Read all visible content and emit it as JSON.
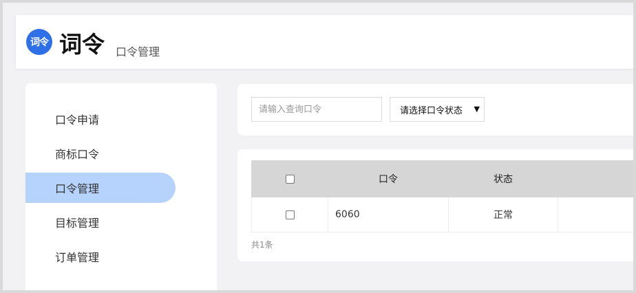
{
  "header": {
    "logo_text": "词令",
    "brand": "词令",
    "subtitle": "口令管理"
  },
  "sidebar": {
    "items": [
      {
        "label": "口令申请",
        "active": false
      },
      {
        "label": "商标口令",
        "active": false
      },
      {
        "label": "口令管理",
        "active": true
      },
      {
        "label": "目标管理",
        "active": false
      },
      {
        "label": "订单管理",
        "active": false
      }
    ]
  },
  "filters": {
    "search_placeholder": "请输入查询口令",
    "status_select": "请选择口令状态"
  },
  "table": {
    "columns": [
      "",
      "口令",
      "状态",
      ""
    ],
    "rows": [
      {
        "keyword": "6060",
        "status": "正常"
      }
    ],
    "total": "共1条"
  },
  "colors": {
    "accent": "#2f6fe8",
    "active_nav": "#b6d3fd",
    "table_header": "#d6d6d6"
  }
}
